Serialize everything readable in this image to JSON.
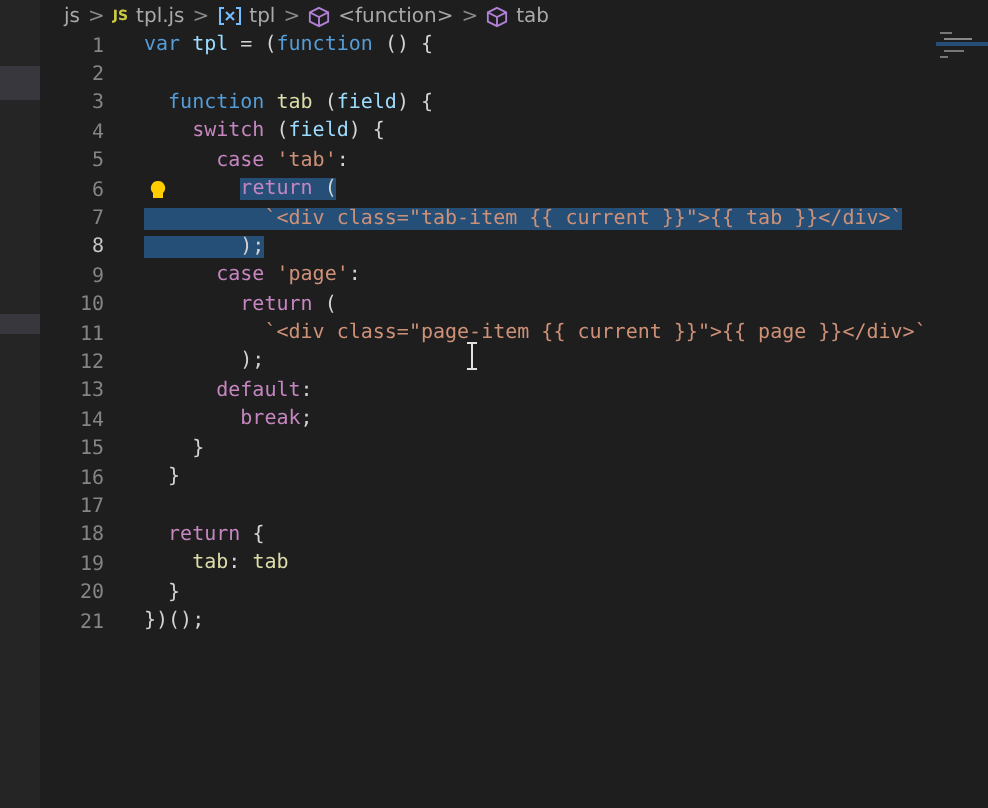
{
  "breadcrumb": [
    {
      "text": "js",
      "kind": "folder"
    },
    {
      "text": "JS",
      "kind": "js-badge"
    },
    {
      "text": "tpl.js",
      "kind": "file"
    },
    {
      "text": "tpl",
      "kind": "variable"
    },
    {
      "text": "<function>",
      "kind": "symbol"
    },
    {
      "text": "tab",
      "kind": "symbol"
    }
  ],
  "separator": ">",
  "lines": [
    {
      "number": "1",
      "current": false,
      "tokens": [
        {
          "text": "var ",
          "kind": "keyword"
        },
        {
          "text": "tpl",
          "kind": "variable"
        },
        {
          "text": " = (",
          "kind": "punct"
        },
        {
          "text": "function",
          "kind": "keyword"
        },
        {
          "text": " () {",
          "kind": "punct"
        }
      ]
    },
    {
      "number": "2",
      "current": false
    },
    {
      "number": "3",
      "current": false,
      "tokens": [
        {
          "text": "  function ",
          "kind": "keyword"
        },
        {
          "text": "tab",
          "kind": "fn"
        },
        {
          "text": " (",
          "kind": "punct"
        },
        {
          "text": "field",
          "kind": "variable"
        },
        {
          "text": ") {",
          "kind": "punct"
        }
      ]
    },
    {
      "number": "4",
      "current": false,
      "tokens": [
        {
          "text": "    switch",
          "kind": "control"
        },
        {
          "text": " (",
          "kind": "punct"
        },
        {
          "text": "field",
          "kind": "variable"
        },
        {
          "text": ") {",
          "kind": "punct"
        }
      ]
    },
    {
      "number": "5",
      "current": false,
      "tokens": [
        {
          "text": "      case ",
          "kind": "control"
        },
        {
          "text": "'tab'",
          "kind": "string"
        },
        {
          "text": ":",
          "kind": "punct"
        }
      ]
    },
    {
      "number": "6",
      "selected": true,
      "full_width": false,
      "current": false,
      "lightbulb": true,
      "tokens": [
        {
          "text": "        return",
          "kind": "control"
        },
        {
          "text": " (",
          "kind": "punct"
        }
      ]
    },
    {
      "number": "7",
      "selected": true,
      "full_width": true,
      "current": false,
      "tokens": [
        {
          "text": "          `<div class=\"tab-item {{ current }}\">{{ tab }}</div>`",
          "kind": "string"
        }
      ]
    },
    {
      "number": "8",
      "selected": true,
      "full_width": true,
      "current": true,
      "tokens": [
        {
          "text": "        );",
          "kind": "punct"
        }
      ]
    },
    {
      "number": "9",
      "current": false,
      "tokens": [
        {
          "text": "      case ",
          "kind": "control"
        },
        {
          "text": "'page'",
          "kind": "string"
        },
        {
          "text": ":",
          "kind": "punct"
        }
      ]
    },
    {
      "number": "10",
      "current": false,
      "tokens": [
        {
          "text": "        return",
          "kind": "control"
        },
        {
          "text": " (",
          "kind": "punct"
        }
      ]
    },
    {
      "number": "11",
      "current": false,
      "tokens": [
        {
          "text": "          `<div class=\"page-item {{ current }}\">{{ page }}</div>`",
          "kind": "string"
        }
      ]
    },
    {
      "number": "12",
      "current": false,
      "tokens": [
        {
          "text": "        );",
          "kind": "punct"
        }
      ]
    },
    {
      "number": "13",
      "current": false,
      "tokens": [
        {
          "text": "      default",
          "kind": "control"
        },
        {
          "text": ":",
          "kind": "punct"
        }
      ]
    },
    {
      "number": "14",
      "current": false,
      "tokens": [
        {
          "text": "        break",
          "kind": "control"
        },
        {
          "text": ";",
          "kind": "punct"
        }
      ]
    },
    {
      "number": "15",
      "current": false,
      "tokens": [
        {
          "text": "    }",
          "kind": "punct"
        }
      ]
    },
    {
      "number": "16",
      "current": false,
      "tokens": [
        {
          "text": "  }",
          "kind": "punct"
        }
      ]
    },
    {
      "number": "17",
      "current": false
    },
    {
      "number": "18",
      "current": false,
      "tokens": [
        {
          "text": "  return",
          "kind": "control"
        },
        {
          "text": " {",
          "kind": "punct"
        }
      ]
    },
    {
      "number": "19",
      "current": false,
      "tokens": [
        {
          "text": "    tab",
          "kind": "fn"
        },
        {
          "text": ": ",
          "kind": "punct"
        },
        {
          "text": "tab",
          "kind": "fn"
        }
      ]
    },
    {
      "number": "20",
      "current": false,
      "tokens": [
        {
          "text": "  }",
          "kind": "punct"
        }
      ]
    },
    {
      "number": "21",
      "current": false,
      "tokens": [
        {
          "text": "})();",
          "kind": "punct"
        }
      ]
    }
  ]
}
